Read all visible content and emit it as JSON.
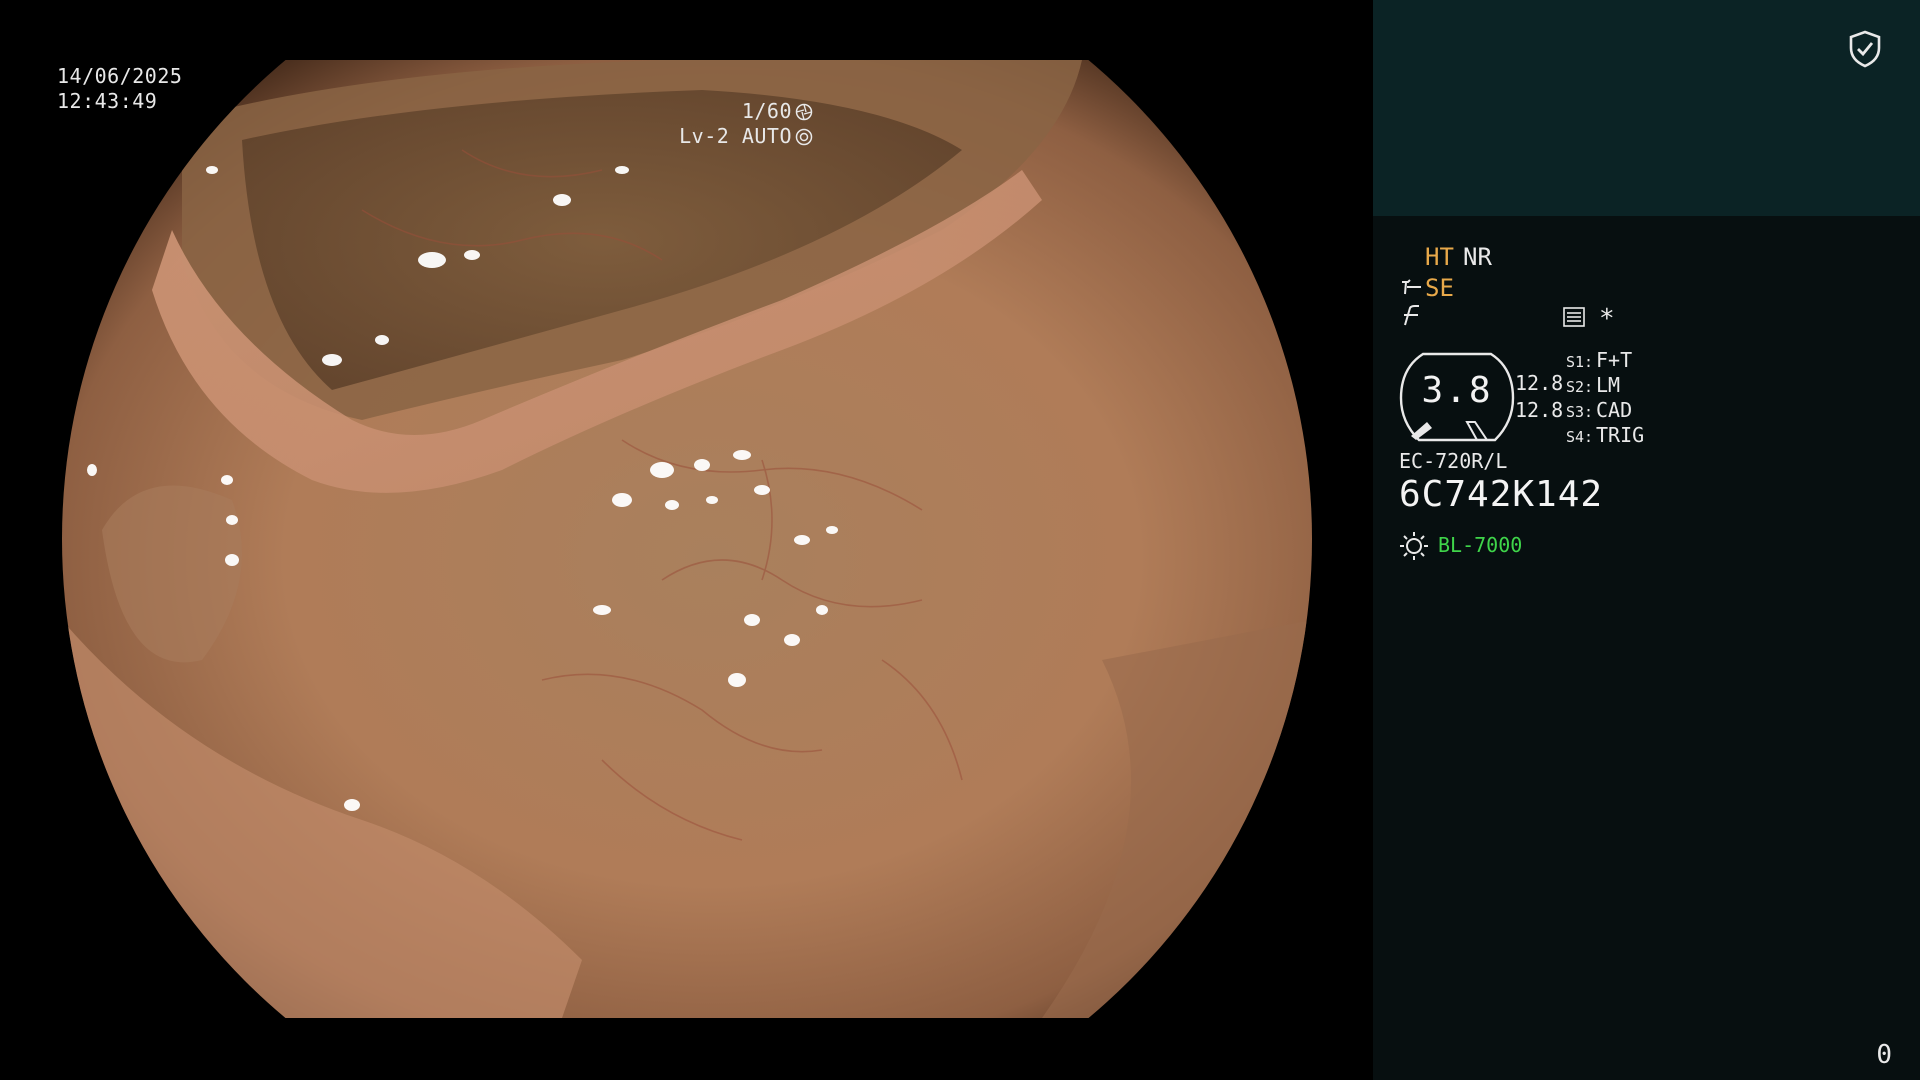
{
  "overlay": {
    "date": "14/06/2025",
    "time": "12:43:49",
    "shutter": "1/60",
    "iris": "Lv-2 AUTO"
  },
  "panel": {
    "ht": "HT",
    "nr": "NR",
    "se": "SE",
    "star": "*",
    "gauge_value": "3.8",
    "gauge_upper": "12.8",
    "gauge_lower": "12.8",
    "switches": [
      {
        "key": "S1:",
        "value": "F+T"
      },
      {
        "key": "S2:",
        "value": "LM"
      },
      {
        "key": "S3:",
        "value": "CAD"
      },
      {
        "key": "S4:",
        "value": "TRIG"
      }
    ],
    "scope_model": "EC-720R/L",
    "serial": "6C742K142",
    "light_source": "BL-7000",
    "counter": "0"
  },
  "colors": {
    "panel_bg": "#070f10",
    "panel_top_bg": "#0b2325",
    "accent_orange": "#e8a94a",
    "light_green": "#3fd54a",
    "tissue": "#b47f5a"
  },
  "icons": {
    "shield": "shield-check-icon",
    "se": "scope-se-icon",
    "f": "f-hook-icon",
    "menu": "settings-list-icon",
    "light": "light-bulb-icon"
  }
}
